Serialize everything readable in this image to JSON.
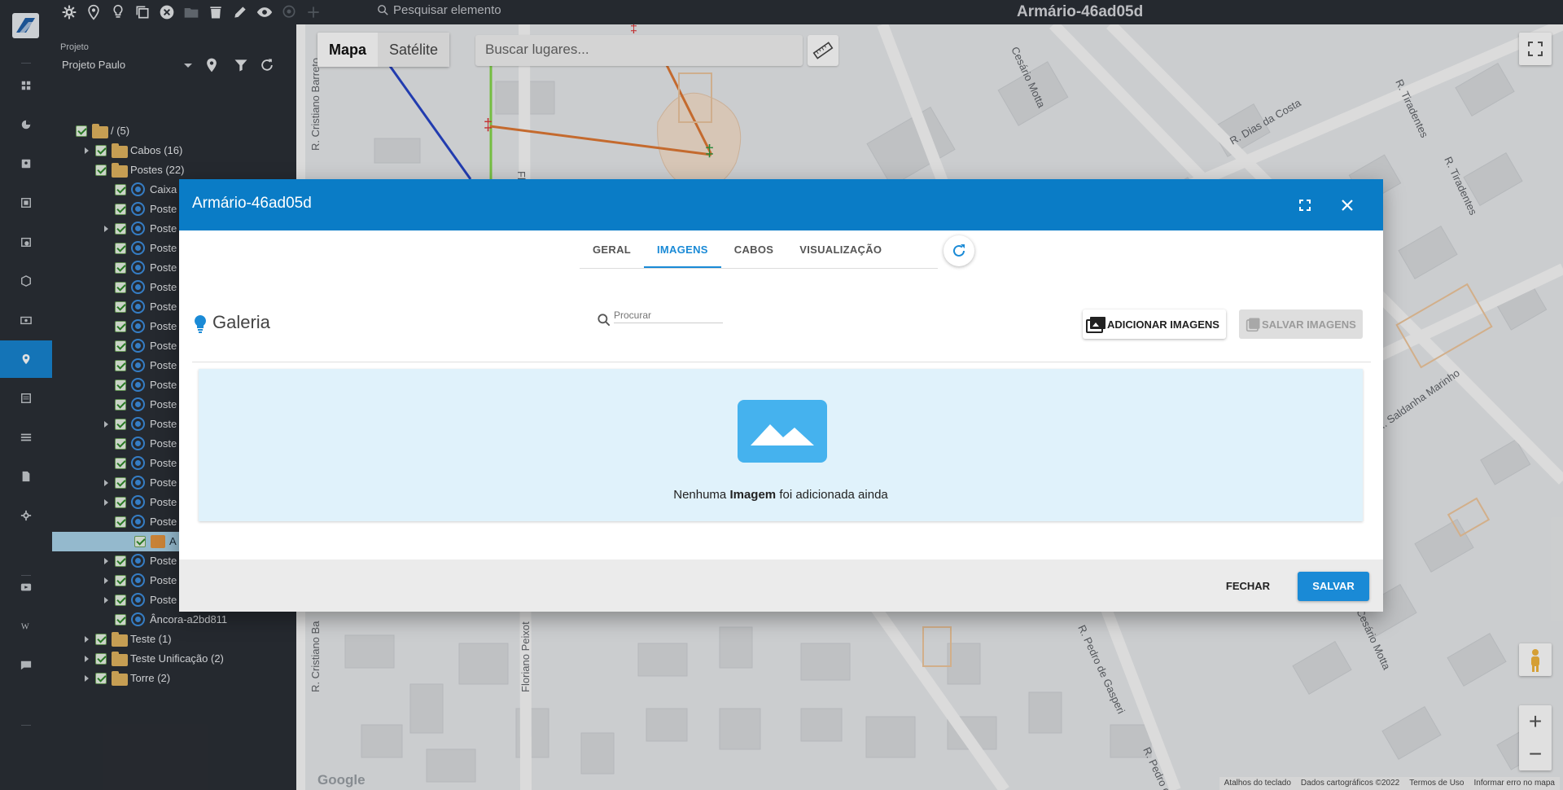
{
  "header": {
    "search_placeholder": "Pesquisar elemento",
    "title": "Armário-46ad05d",
    "tools": [
      "gear-icon",
      "pin-icon",
      "bulb-icon",
      "copy-icon",
      "close-circle-icon",
      "folder-icon",
      "trash-icon",
      "pencil-icon",
      "eye-icon",
      "location-off-icon",
      "plus-icon"
    ]
  },
  "rail": {
    "items": [
      "dashboard-icon",
      "pie-chart-icon",
      "contacts-icon",
      "gallery-icon",
      "clock-calendar-icon",
      "box-icon",
      "money-icon",
      "map-pin-icon",
      "list-icon",
      "table-icon",
      "document-icon",
      "settings-icon",
      "video-icon",
      "wiki-icon",
      "chat-icon"
    ],
    "active": "map-pin-icon"
  },
  "project": {
    "label": "Projeto",
    "value": "Projeto Paulo"
  },
  "tree": [
    {
      "text": "/ (5)",
      "icon": "folder"
    },
    {
      "text": "Cabos (16)",
      "icon": "folder"
    },
    {
      "text": "Postes (22)",
      "icon": "folder"
    },
    {
      "text": "Caixa",
      "icon": "pole"
    },
    {
      "text": "Poste",
      "icon": "pole"
    },
    {
      "text": "Poste",
      "icon": "pole"
    },
    {
      "text": "Poste",
      "icon": "pole"
    },
    {
      "text": "Poste",
      "icon": "pole"
    },
    {
      "text": "Poste",
      "icon": "pole"
    },
    {
      "text": "Poste",
      "icon": "pole"
    },
    {
      "text": "Poste",
      "icon": "pole"
    },
    {
      "text": "Poste",
      "icon": "pole"
    },
    {
      "text": "Poste",
      "icon": "pole"
    },
    {
      "text": "Poste",
      "icon": "pole"
    },
    {
      "text": "Poste",
      "icon": "pole"
    },
    {
      "text": "Poste",
      "icon": "pole"
    },
    {
      "text": "Poste",
      "icon": "pole"
    },
    {
      "text": "Poste",
      "icon": "pole"
    },
    {
      "text": "Poste",
      "icon": "pole"
    },
    {
      "text": "Poste",
      "icon": "pole"
    },
    {
      "text": "Poste",
      "icon": "pole"
    },
    {
      "text": "A",
      "icon": "cabinet"
    },
    {
      "text": "Poste",
      "icon": "pole"
    },
    {
      "text": "Poste",
      "icon": "pole"
    },
    {
      "text": "Poste",
      "icon": "pole"
    },
    {
      "text": "Âncora-a2bd811",
      "icon": "pole"
    },
    {
      "text": "Teste (1)",
      "icon": "folder"
    },
    {
      "text": "Teste Unificação (2)",
      "icon": "folder"
    },
    {
      "text": "Torre (2)",
      "icon": "folder"
    }
  ],
  "map": {
    "tab_map": "Mapa",
    "tab_satellite": "Satélite",
    "search_placeholder": "Buscar lugares...",
    "google": "Google",
    "footer": [
      "Atalhos do teclado",
      "Dados cartográficos ©2022",
      "Termos de Uso",
      "Informar erro no mapa"
    ],
    "streets": [
      "R. Cristiano Barreto",
      "Cesário Motta",
      "R. Dias da Costa",
      "R. Tiradentes",
      "R. Tiradentes",
      "R. Saldanha Marinho",
      "Floria",
      "R. Cristiano Ba",
      "Floriano Peixot",
      "R. Pedro de Gasperi",
      "R. Pedro de",
      "Cesário Motta"
    ]
  },
  "dialog": {
    "title": "Armário-46ad05d",
    "tabs": [
      "GERAL",
      "IMAGENS",
      "CABOS",
      "VISUALIZAÇÃO"
    ],
    "active_tab": "IMAGENS",
    "gallery_title": "Galeria",
    "search_placeholder": "Procurar",
    "add_images": "ADICIONAR IMAGENS",
    "save_images": "SALVAR IMAGENS",
    "empty_pre": "Nenhuma ",
    "empty_bold": "Imagem",
    "empty_post": " foi adicionada ainda",
    "close": "FECHAR",
    "save": "SALVAR"
  },
  "colors": {
    "accent": "#1a8ad6",
    "header_blue": "#0a7cc6",
    "dark_bg": "#2b2f36"
  }
}
